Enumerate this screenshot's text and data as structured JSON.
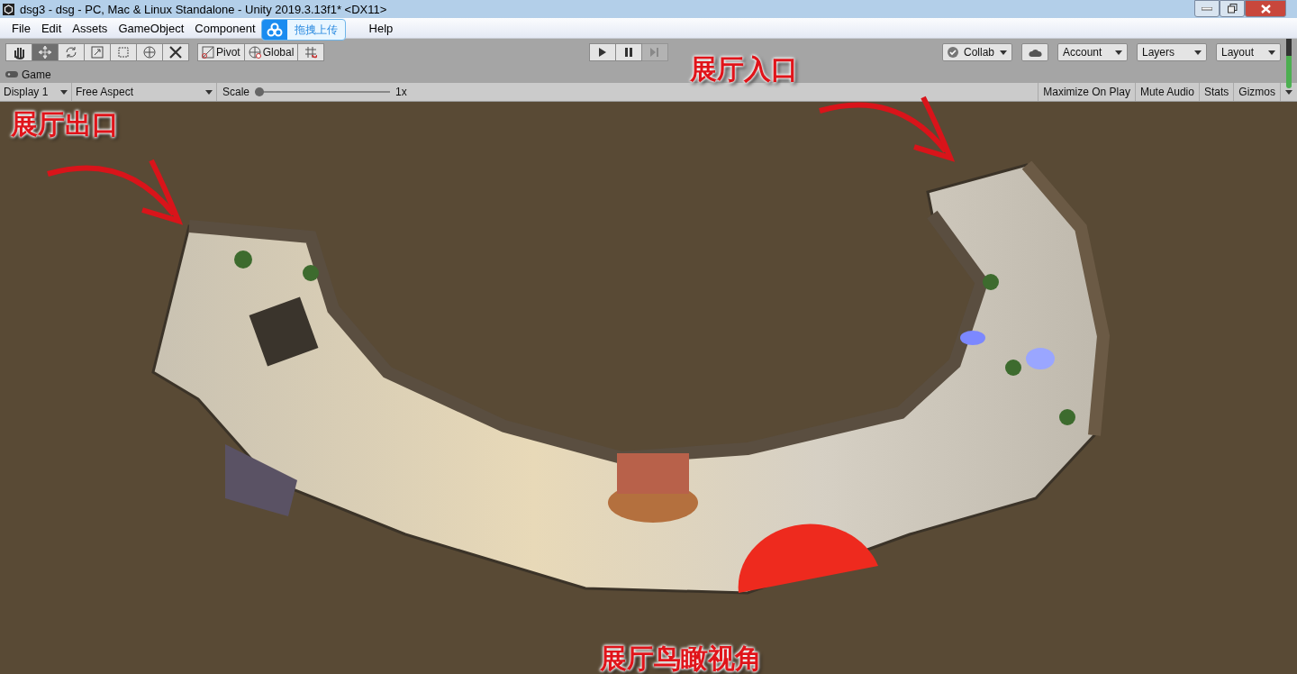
{
  "window": {
    "title": "dsg3 - dsg - PC, Mac & Linux Standalone - Unity 2019.3.13f1* <DX11>"
  },
  "menu": [
    "File",
    "Edit",
    "Assets",
    "GameObject",
    "Component",
    "Help"
  ],
  "upload_widget": {
    "label": "拖拽上传"
  },
  "toolbar": {
    "tools": [
      {
        "kind": "hand",
        "selected": false
      },
      {
        "kind": "move",
        "selected": true
      },
      {
        "kind": "rotate",
        "selected": false
      },
      {
        "kind": "scale",
        "selected": false
      },
      {
        "kind": "rect",
        "selected": false
      },
      {
        "kind": "transform",
        "selected": false
      },
      {
        "kind": "custom",
        "selected": false
      }
    ],
    "pivot": "Pivot",
    "global": "Global",
    "playback": [
      {
        "kind": "play",
        "disabled": false
      },
      {
        "kind": "pause",
        "disabled": false
      },
      {
        "kind": "step",
        "disabled": true
      }
    ],
    "collab": "Collab",
    "account": "Account",
    "layers": "Layers",
    "layout": "Layout"
  },
  "game_tab": {
    "label": "Game"
  },
  "game_bar": {
    "display": "Display 1",
    "aspect": "Free Aspect",
    "scale_label": "Scale",
    "scale": {
      "level": 0
    },
    "scale_value": "1x",
    "toggles": [
      "Maximize On Play",
      "Mute Audio",
      "Stats",
      "Gizmos"
    ]
  },
  "annotations": [
    {
      "kind": "exit",
      "text": "展厅出口"
    },
    {
      "kind": "entrance",
      "text": "展厅入口"
    },
    {
      "kind": "overview",
      "text": "展厅鸟瞰视角"
    }
  ]
}
